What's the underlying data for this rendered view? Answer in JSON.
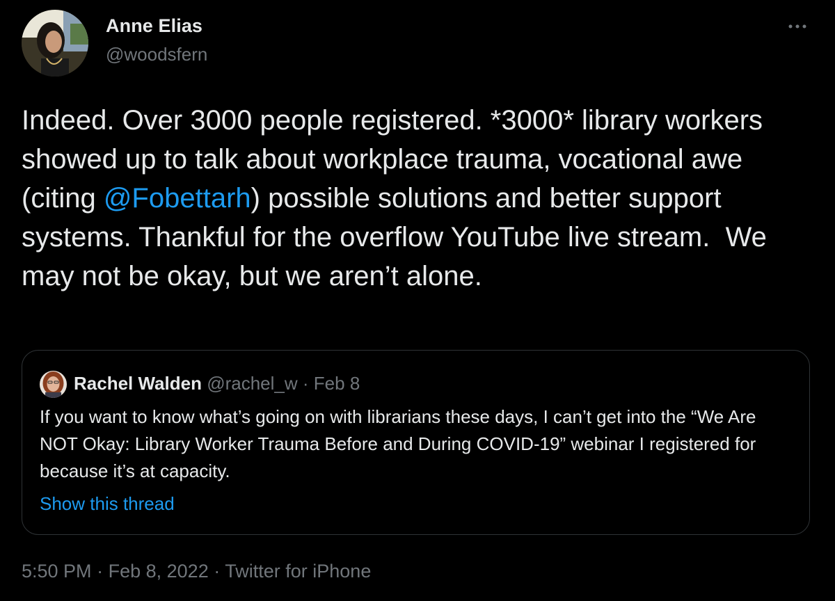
{
  "author": {
    "name": "Anne Elias",
    "handle": "@woodsfern",
    "avatar_icon": "profile-photo"
  },
  "tweet": {
    "text_before_mention": "Indeed. Over 3000 people registered. *3000* library workers showed up to talk about workplace trauma, vocational awe (citing ",
    "mention": "@Fobettarh",
    "text_after_mention": ") possible solutions and better support systems. Thankful for the overflow YouTube live stream.  We may not be okay, but we aren’t alone."
  },
  "quoted_tweet": {
    "name": "Rachel Walden",
    "handle": "@rachel_w",
    "separator": "·",
    "date": "Feb 8",
    "text": "If you want to know what’s going on with librarians these days, I can’t get into the “We Are NOT Okay: Library Worker Trauma Before and During COVID-19” webinar I registered for because it’s at capacity.",
    "show_thread_label": "Show this thread"
  },
  "meta": {
    "time": "5:50 PM",
    "separator": "·",
    "date": "Feb 8, 2022",
    "source": "Twitter for iPhone"
  },
  "icons": {
    "more": "more-horizontal-icon"
  },
  "colors": {
    "background": "#000000",
    "text": "#e7e9ea",
    "secondary_text": "#71767b",
    "link": "#1d9bf0",
    "border": "#2f3336"
  }
}
